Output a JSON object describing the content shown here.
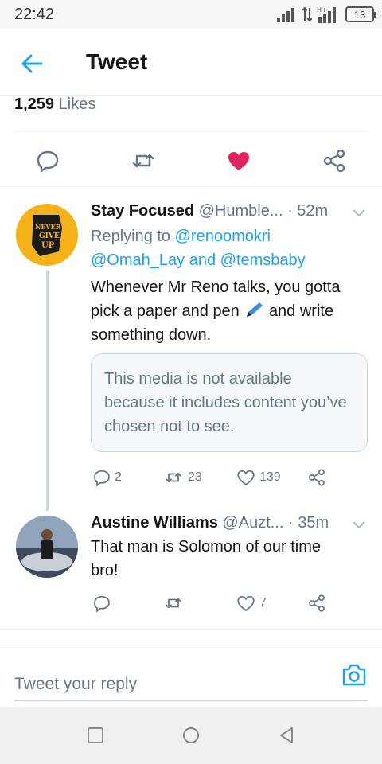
{
  "status_bar": {
    "time": "22:42",
    "battery": "13"
  },
  "header": {
    "title": "Tweet",
    "back_icon": "arrow-left-icon"
  },
  "likes": {
    "count": "1,259",
    "label": "Likes"
  },
  "main_actions": {
    "icons": [
      "reply-icon",
      "retweet-icon",
      "heart-filled-icon",
      "share-icon"
    ],
    "liked_color": "#e0245e"
  },
  "tweets": [
    {
      "name": "Stay Focused",
      "handle": "@Humble...",
      "time": "· 52m",
      "replying_prefix": "Replying to",
      "replying_line1_mention": "@renoomokri",
      "replying_line2_mention1": "@Omah_Lay",
      "replying_line2_and": "and",
      "replying_line2_mention2": "@temsbaby",
      "text_line1": "Whenever Mr Reno talks, you gotta",
      "text_line2a": "pick a paper and pen",
      "text_line2b": "and write",
      "text_line3": "something down.",
      "media_notice": "This media is not available because it includes content you’ve chosen not to see.",
      "avatar_text_1": "NEVER",
      "avatar_text_2": "GIVE",
      "avatar_text_3": "UP",
      "replies": "2",
      "retweets": "23",
      "likes": "139"
    },
    {
      "name": "Austine Williams",
      "handle": "@Auzt...",
      "time": "· 35m",
      "text_line1": "That man is Solomon of our time",
      "text_line2": "bro!",
      "likes": "7"
    }
  ],
  "reply_bar": {
    "placeholder": "Tweet your reply",
    "camera_icon": "camera-icon"
  },
  "nav_bar": {
    "icons": [
      "square-icon",
      "circle-icon",
      "triangle-back-icon"
    ]
  },
  "colors": {
    "accent": "#1da1f2",
    "text_secondary": "#657786",
    "divider": "#e6ecf0"
  }
}
